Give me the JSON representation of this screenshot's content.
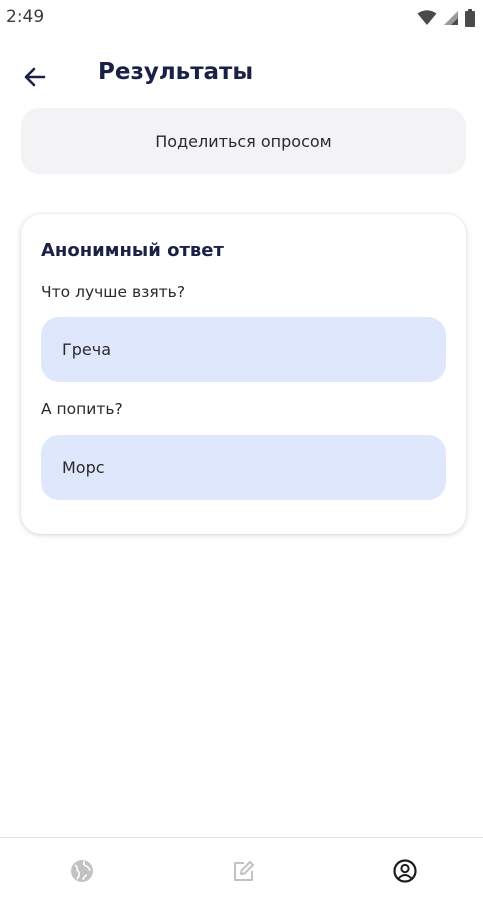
{
  "status_bar": {
    "time": "2:49",
    "icons": [
      "wifi-icon",
      "signal-icon",
      "battery-icon"
    ]
  },
  "header": {
    "back_icon": "arrow-left-icon",
    "title": "Результаты"
  },
  "share_button": {
    "label": "Поделиться опросом"
  },
  "result_card": {
    "title": "Анонимный ответ",
    "items": [
      {
        "question": "Что лучше взять?",
        "answer": "Греча"
      },
      {
        "question": "А попить?",
        "answer": "Морс"
      }
    ]
  },
  "bottom_nav": {
    "items": [
      {
        "icon": "globe-icon",
        "active": false
      },
      {
        "icon": "edit-icon",
        "active": false
      },
      {
        "icon": "profile-icon",
        "active": true
      }
    ]
  },
  "colors": {
    "title": "#1a2046",
    "answer_bg": "#dfe7fd",
    "share_bg": "#f3f3f5",
    "nav_active": "#1c1c1e",
    "nav_inactive": "#c2c2c2"
  }
}
